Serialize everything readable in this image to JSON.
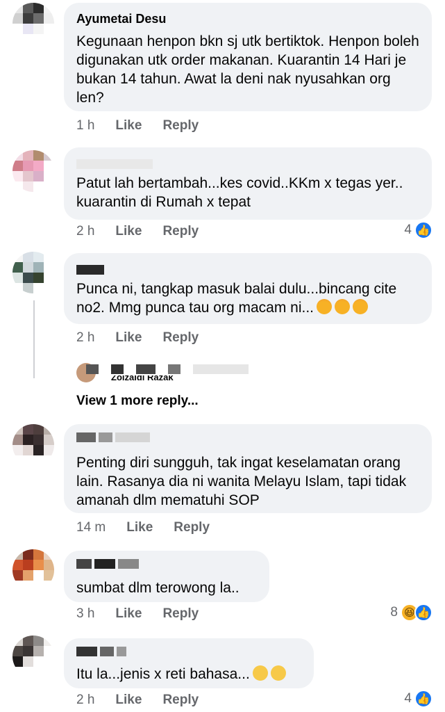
{
  "comments": [
    {
      "name": "Ayumetai Desu",
      "text": "Kegunaan henpon bkn sj utk bertiktok. Henpon boleh digunakan utk order makanan. Kuarantin 14 Hari je bukan 14 tahun. Awat la deni nak nyusahkan org len?",
      "time": "1 h",
      "like": "Like",
      "reply": "Reply",
      "reaction_count": "",
      "avatar_colors": [
        "#e6e6e6",
        "#5a5a5a",
        "#2c2c2c",
        "#f2f2f2",
        "#d0d0d0",
        "#3c3c3c",
        "#6c6c6c",
        "#eeeeee",
        "#ffffff",
        "#e8e6f4",
        "#f4f4f4",
        "#ffffff",
        "#ffffff",
        "#ffffff",
        "#ffffff",
        "#ffffff"
      ]
    },
    {
      "name": "",
      "text": "Patut lah bertambah...kes covid..KKm x tegas yer.. kuarantin di Rumah x tepat",
      "time": "2 h",
      "like": "Like",
      "reply": "Reply",
      "reaction_count": "4",
      "avatar_colors": [
        "#f3dde6",
        "#e4b3bb",
        "#b18c6e",
        "#d5c9cf",
        "#cf7d89",
        "#e79ab4",
        "#f3aac6",
        "#ffffff",
        "#fbe9ef",
        "#e4c6cd",
        "#d9b0c8",
        "#ffffff",
        "#ffffff",
        "#f5e8ec",
        "#ffffff",
        "#ffffff"
      ]
    },
    {
      "name": "",
      "text": "Punca ni, tangkap masuk balai dulu...bincang cite no2. Mmg punca tau org macam ni...",
      "time": "2 h",
      "like": "Like",
      "reply": "Reply",
      "reaction_count": "",
      "avatar_colors": [
        "#f5f5f5",
        "#d8dfe6",
        "#e3ebef",
        "#ffffff",
        "#41604d",
        "#d2d9dd",
        "#9fb3b7",
        "#ffffff",
        "#dce5e3",
        "#3b4b4c",
        "#35432f",
        "#ffffff",
        "#ffffff",
        "#c7cfcf",
        "#ffffff",
        "#ffffff"
      ]
    },
    {
      "name": "",
      "text": "Penting diri sungguh, tak ingat keselamatan orang lain. Rasanya dia ni wanita Melayu Islam, tapi tidak amanah dlm mematuhi SOP",
      "time": "14 m",
      "like": "Like",
      "reply": "Reply",
      "reaction_count": "",
      "avatar_colors": [
        "#cfc3bd",
        "#5a4548",
        "#4e3e3d",
        "#b8aea8",
        "#a38d88",
        "#2b2122",
        "#3a2f30",
        "#d6cdc9",
        "#f3eeee",
        "#e1d6d3",
        "#2a2324",
        "#efeaea",
        "#ffffff",
        "#ffffff",
        "#ffffff",
        "#ffffff"
      ]
    },
    {
      "name": "",
      "text": "sumbat dlm terowong la..",
      "time": "3 h",
      "like": "Like",
      "reply": "Reply",
      "reaction_count": "8",
      "avatar_colors": [
        "#c9b8aa",
        "#7a2b1d",
        "#d5763c",
        "#e8d2c1",
        "#d0532b",
        "#ba3e1f",
        "#e98e4a",
        "#dfb58a",
        "#a03a24",
        "#e4a26b",
        "#ffffff",
        "#e2c199",
        "#ffffff",
        "#ffffff",
        "#ffffff",
        "#ffffff"
      ]
    },
    {
      "name": "",
      "text": "Itu la...jenis x reti bahasa...",
      "time": "2 h",
      "like": "Like",
      "reply": "Reply",
      "reaction_count": "4",
      "avatar_colors": [
        "#d8d4d0",
        "#5f5754",
        "#8d8a88",
        "#f1efed",
        "#4d4744",
        "#3a3534",
        "#b6b1ae",
        "#ffffff",
        "#1c1a1a",
        "#e2dedc",
        "#ffffff",
        "#ffffff",
        "#ffffff",
        "#ffffff",
        "#ffffff",
        "#ffffff"
      ]
    }
  ],
  "reply_preview": {
    "name": "Zolzaidi Razak"
  },
  "view_more": "View 1 more reply..."
}
